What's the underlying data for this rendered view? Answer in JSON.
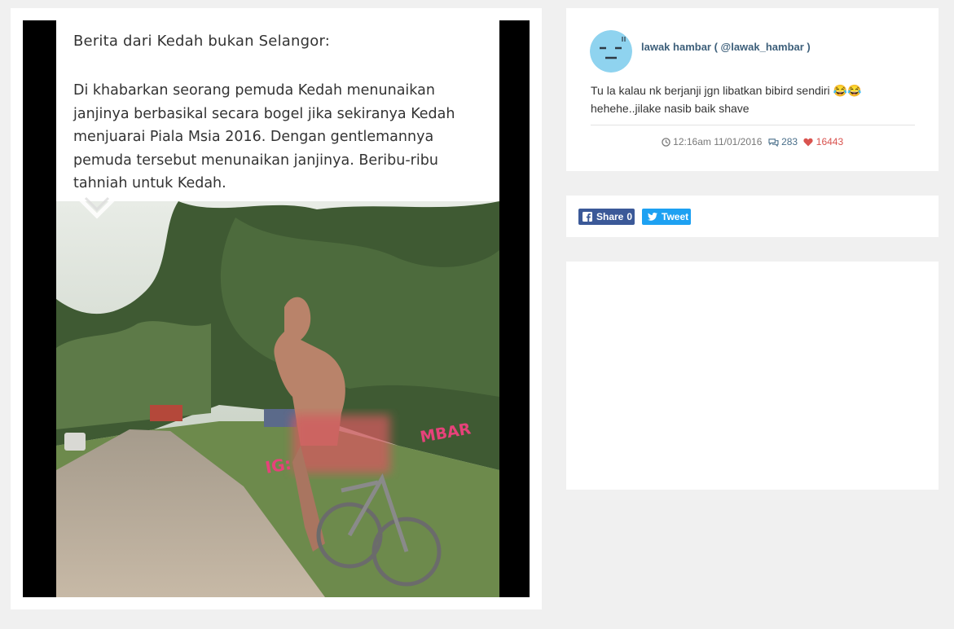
{
  "post_image": {
    "caption_title": "Berita dari Kedah bukan Selangor:",
    "caption_body": "Di khabarkan seorang pemuda Kedah menunaikan janjinya berbasikal secara bogel jika sekiranya Kedah menjuarai Piala Msia 2016. Dengan gentlemannya pemuda tersebut menunaikan janjinya. Beribu-ribu tahniah untuk Kedah.",
    "watermark_text": "IG: @LAWAKHAMBAR",
    "watermark_prefix": "IG:",
    "watermark_suffix": "MBAR"
  },
  "profile": {
    "display_name": "lawak hambar ( @lawak_hambar )",
    "post_text_line1": "Tu la kalau nk berjanji jgn libatkan bibird sendiri 😂😂",
    "post_text_line2": "hehehe..jilake nasib baik shave",
    "timestamp": "12:16am 11/01/2016",
    "comments": "283",
    "likes": "16443",
    "icons": {
      "clock": "clock-icon",
      "comments": "comments-icon",
      "likes": "heart-icon"
    },
    "colors": {
      "name": "#3d5f7a",
      "likes": "#d9534f",
      "avatar": "#8fd3ef"
    }
  },
  "share": {
    "facebook_label": "Share",
    "facebook_count": "0",
    "twitter_label": "Tweet",
    "colors": {
      "facebook": "#3b5998",
      "twitter": "#1da1f2"
    }
  }
}
